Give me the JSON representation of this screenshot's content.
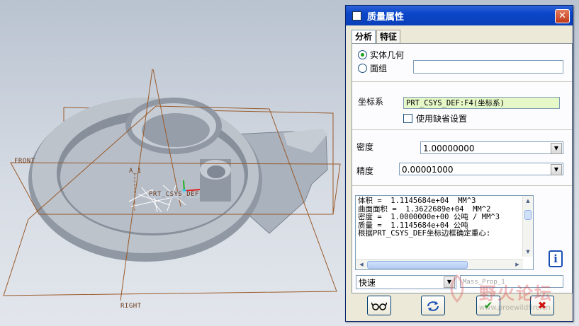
{
  "viewport": {
    "labels": {
      "front": "FRONT",
      "right": "RIGHT",
      "a1": "A_1",
      "csys": "PRT_CSYS_DEF"
    }
  },
  "dialog": {
    "title": "质量属性",
    "close_glyph": "✕",
    "tabs": [
      {
        "label": "分析",
        "active": true
      },
      {
        "label": "特征",
        "active": false
      }
    ],
    "geometry_options": [
      {
        "label": "实体几何",
        "selected": true
      },
      {
        "label": "面组",
        "selected": false
      }
    ],
    "surface_value": "",
    "csys_label": "坐标系",
    "csys_value": "PRT_CSYS_DEF:F4(坐标系)",
    "use_default_label": "使用缺省设置",
    "use_default_checked": false,
    "density_label": "密度",
    "density_value": "1.00000000",
    "accuracy_label": "精度",
    "accuracy_value": "0.00001000",
    "results": [
      "体积 =  1.1145684e+04  MM^3",
      "曲面面积 =  1.3622689e+04  MM^2",
      "密度 =  1.0000000e+00 公吨 / MM^3",
      "质量 =  1.1145684e+04 公吨",
      "",
      "根据PRT_CSYS_DEF坐标边框确定重心:"
    ],
    "mode_value": "快速",
    "name_placeholder": "Mass_Prop_1",
    "info_glyph": "i",
    "buttons": {
      "glasses_icon": "glasses-icon",
      "repeat_icon": "repeat-icon",
      "ok_glyph": "✔",
      "cancel_glyph": "✖"
    },
    "colors": {
      "csys_field_bg": "#e6f8c8",
      "ok_green": "#1e9a1e",
      "cancel_red": "#d01010"
    }
  },
  "watermark": {
    "text": "野火论坛",
    "url": "www.proewildfire.cn"
  }
}
